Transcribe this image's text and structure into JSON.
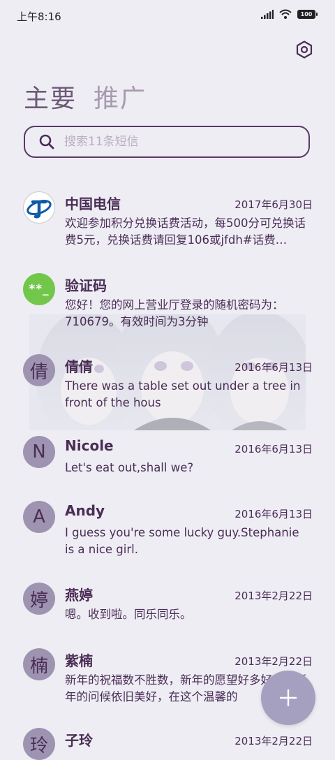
{
  "status_bar": {
    "time": "上午8:16",
    "battery": "100"
  },
  "tabs": [
    {
      "label": "主要",
      "active": true
    },
    {
      "label": "推广",
      "active": false
    }
  ],
  "search": {
    "placeholder": "搜索11条短信"
  },
  "conversations": [
    {
      "avatar_type": "telecom",
      "avatar_text": "",
      "name": "中国电信",
      "date": "2017年6月30日",
      "preview": "欢迎参加积分兑换话费活动，每500分可兑换话费5元，兑换话费请回复106或jfdh#话费…"
    },
    {
      "avatar_type": "green",
      "avatar_text": "**_",
      "name": "验证码",
      "date": "",
      "preview": "您好！您的网上营业厅登录的随机密码为：710679。有效时间为3分钟"
    },
    {
      "avatar_type": "letter",
      "avatar_text": "倩",
      "name": "倩倩",
      "date": "2016年6月13日",
      "preview": "There was a table set out under a tree in front of the hous"
    },
    {
      "avatar_type": "letter",
      "avatar_text": "N",
      "name": "Nicole",
      "date": "2016年6月13日",
      "preview": "Let's eat out,shall we?"
    },
    {
      "avatar_type": "letter",
      "avatar_text": "A",
      "name": "Andy",
      "date": "2016年6月13日",
      "preview": "I guess you're some lucky guy.Stephanie is a nice girl."
    },
    {
      "avatar_type": "letter",
      "avatar_text": "婷",
      "name": "燕婷",
      "date": "2013年2月22日",
      "preview": "嗯。收到啦。同乐同乐。"
    },
    {
      "avatar_type": "letter",
      "avatar_text": "楠",
      "name": "紫楠",
      "date": "2013年2月22日",
      "preview": "新年的祝福数不胜数，新年的愿望好多好多，新年的问候依旧美好，在这个温馨的"
    },
    {
      "avatar_type": "letter",
      "avatar_text": "玲",
      "name": "子玲",
      "date": "2013年2月22日",
      "preview": ""
    }
  ],
  "icons": {
    "settings": "settings-hexagon-icon",
    "search": "search-icon",
    "fab": "plus-icon"
  },
  "colors": {
    "accent": "#4a2d55",
    "background": "#eeedf4",
    "avatar": "#9e93b1",
    "fab": "#a59fc0",
    "verify_green": "#72c74b"
  }
}
